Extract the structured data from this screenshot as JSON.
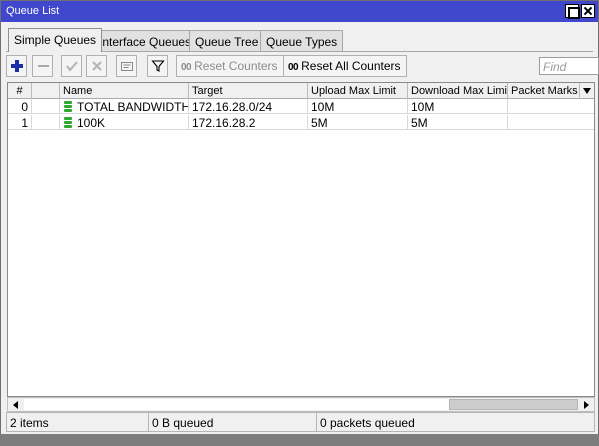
{
  "window": {
    "title": "Queue List"
  },
  "tabs": [
    {
      "label": "Simple Queues",
      "active": true
    },
    {
      "label": "Interface Queues",
      "active": false
    },
    {
      "label": "Queue Tree",
      "active": false
    },
    {
      "label": "Queue Types",
      "active": false
    }
  ],
  "toolbar": {
    "add_icon": "plus-icon",
    "remove_icon": "minus-icon",
    "enable_icon": "check-icon",
    "disable_icon": "x-icon",
    "comment_icon": "comment-icon",
    "filter_icon": "filter-icon",
    "reset_counters_label": "Reset Counters",
    "reset_all_counters_label": "Reset All Counters",
    "counter_prefix": "00",
    "find_placeholder": "Find"
  },
  "table": {
    "columns": [
      "#",
      "",
      "Name",
      "Target",
      "Upload Max Limit",
      "Download Max Limit",
      "Packet Marks"
    ],
    "rows": [
      {
        "index": "0",
        "name": "TOTAL BANDWIDTH",
        "target": "172.16.28.0/24",
        "upload_max": "10M",
        "download_max": "10M",
        "packet_marks": ""
      },
      {
        "index": "1",
        "name": "100K",
        "target": "172.16.28.2",
        "upload_max": "5M",
        "download_max": "5M",
        "packet_marks": ""
      }
    ]
  },
  "status": {
    "items": "2 items",
    "bytes_queued": "0 B queued",
    "packets_queued": "0 packets queued"
  },
  "colors": {
    "titlebar": "#3f48cc",
    "accent_blue": "#1a2ea6",
    "queue_icon_green": "#2fa82f"
  }
}
